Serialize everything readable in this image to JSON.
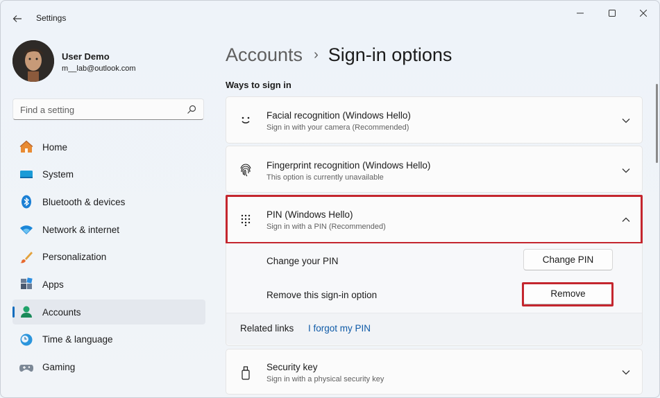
{
  "window": {
    "app_title": "Settings"
  },
  "profile": {
    "name": "User Demo",
    "email": "m__lab@outlook.com"
  },
  "search": {
    "placeholder": "Find a setting"
  },
  "sidebar": {
    "items": [
      {
        "label": "Home",
        "icon": "home-icon"
      },
      {
        "label": "System",
        "icon": "system-icon"
      },
      {
        "label": "Bluetooth & devices",
        "icon": "bluetooth-icon"
      },
      {
        "label": "Network & internet",
        "icon": "wifi-icon"
      },
      {
        "label": "Personalization",
        "icon": "brush-icon"
      },
      {
        "label": "Apps",
        "icon": "apps-icon"
      },
      {
        "label": "Accounts",
        "icon": "accounts-icon",
        "active": true
      },
      {
        "label": "Time & language",
        "icon": "time-language-icon"
      },
      {
        "label": "Gaming",
        "icon": "gaming-icon"
      }
    ]
  },
  "breadcrumb": {
    "parent": "Accounts",
    "separator": "›",
    "current": "Sign-in options"
  },
  "main": {
    "section_title": "Ways to sign in",
    "options": [
      {
        "title": "Facial recognition (Windows Hello)",
        "subtitle": "Sign in with your camera (Recommended)",
        "icon": "smiley-face-icon",
        "expanded": false
      },
      {
        "title": "Fingerprint recognition (Windows Hello)",
        "subtitle": "This option is currently unavailable",
        "icon": "fingerprint-icon",
        "expanded": false
      },
      {
        "title": "PIN (Windows Hello)",
        "subtitle": "Sign in with a PIN (Recommended)",
        "icon": "keypad-icon",
        "expanded": true
      },
      {
        "title": "Security key",
        "subtitle": "Sign in with a physical security key",
        "icon": "usb-key-icon",
        "expanded": false
      }
    ],
    "pin_panel": {
      "change_label": "Change your PIN",
      "change_button": "Change PIN",
      "remove_label": "Remove this sign-in option",
      "remove_button": "Remove",
      "related_label": "Related links",
      "related_link": "I forgot my PIN"
    }
  },
  "colors": {
    "accent": "#0f6cbd",
    "highlight": "#c4262e",
    "link": "#0e5aa7"
  }
}
